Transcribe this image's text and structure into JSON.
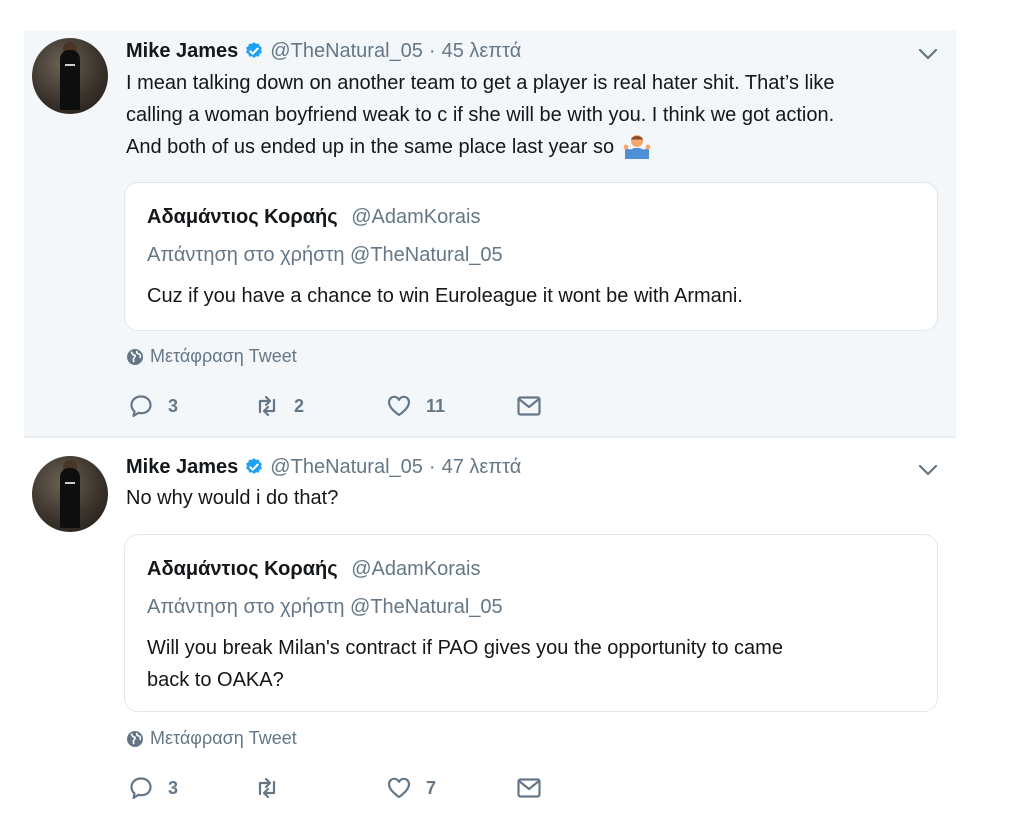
{
  "tweets": [
    {
      "author": "Mike James",
      "handle": "@TheNatural_05",
      "separator": "·",
      "time": "45 λεπτά",
      "text_lines": [
        "I mean talking down on another team to get a player is real hater shit. That’s like",
        "calling a woman boyfriend weak to c if she will be with you. I think we got action.",
        "And both of us ended up in the same place last year so"
      ],
      "emoji": "man-shrugging-emoji",
      "quote": {
        "author": "Αδαμάντιος Κοραής",
        "handle": "@AdamKorais",
        "reply_to": "Απάντηση στο χρήστη @TheNatural_05",
        "text_lines": [
          "Cuz if you have a chance to win Euroleague it wont be with Armani."
        ]
      },
      "translate_label": "Μετάφραση Tweet",
      "replies": "3",
      "retweets": "2",
      "likes": "11"
    },
    {
      "author": "Mike James",
      "handle": "@TheNatural_05",
      "separator": "·",
      "time": "47 λεπτά",
      "text_lines": [
        "No why would i do that?"
      ],
      "quote": {
        "author": "Αδαμάντιος Κοραής",
        "handle": "@AdamKorais",
        "reply_to": "Απάντηση στο χρήστη @TheNatural_05",
        "text_lines": [
          "Will you break Milan's contract if PAO gives you the opportunity to came",
          "back to OAKA?"
        ]
      },
      "translate_label": "Μετάφραση Tweet",
      "replies": "3",
      "retweets": "",
      "likes": "7"
    }
  ],
  "colors": {
    "accent": "#1da1f2",
    "muted": "#657786",
    "text": "#14171a",
    "highlight_bg": "#f4f7fa",
    "border": "#e1e8ed"
  }
}
